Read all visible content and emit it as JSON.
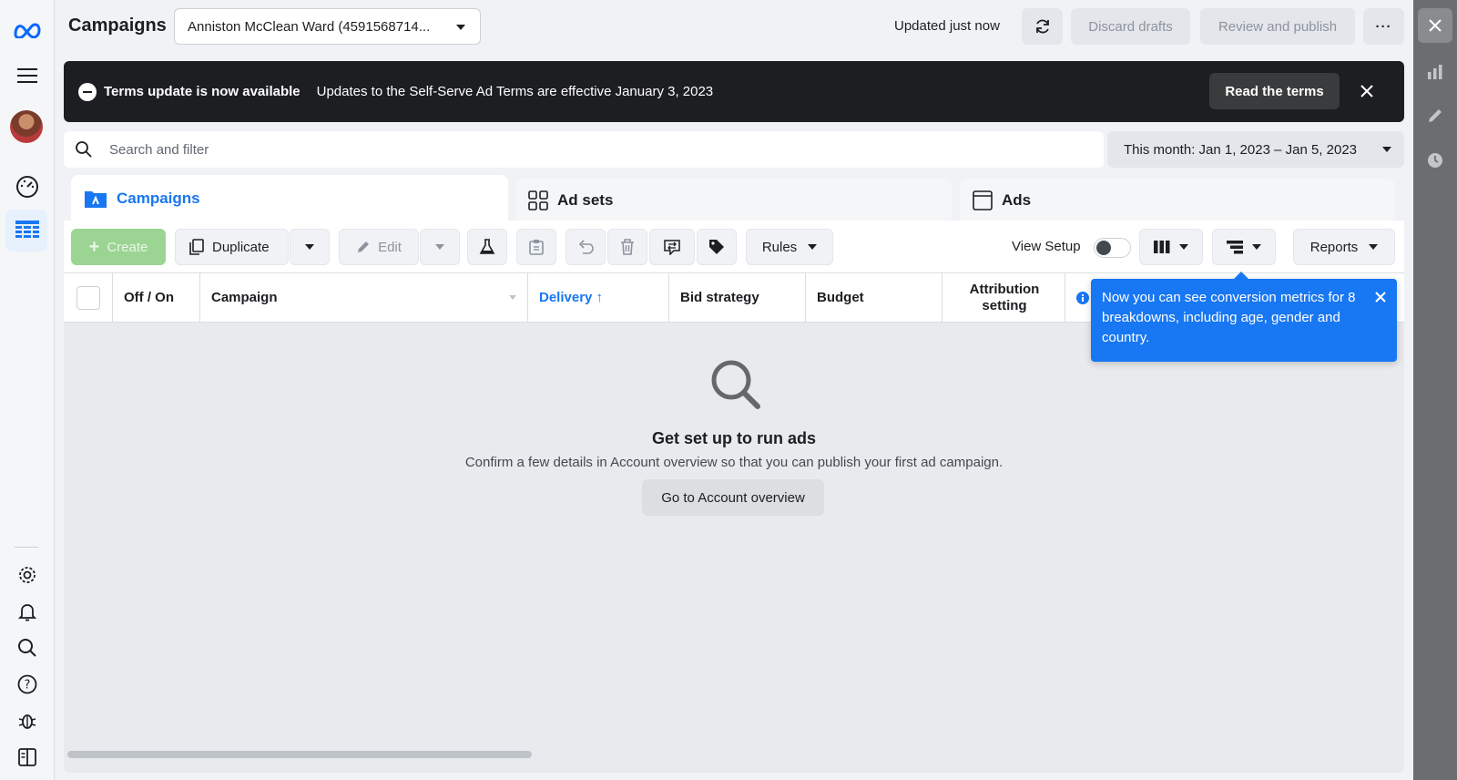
{
  "header": {
    "title": "Campaigns",
    "account_name": "Anniston McClean Ward (4591568714...",
    "status": "Updated just now",
    "discard_label": "Discard drafts",
    "review_label": "Review and publish",
    "more_label": "···"
  },
  "banner": {
    "title": "Terms update is now available",
    "message": "Updates to the Self-Serve Ad Terms are effective January 3, 2023",
    "button_label": "Read the terms"
  },
  "search": {
    "placeholder": "Search and filter"
  },
  "date_range": {
    "label": "This month: Jan 1, 2023 – Jan 5, 2023"
  },
  "tabs": [
    {
      "label": "Campaigns",
      "active": true
    },
    {
      "label": "Ad sets",
      "active": false
    },
    {
      "label": "Ads",
      "active": false
    }
  ],
  "toolbar": {
    "create_label": "Create",
    "duplicate_label": "Duplicate",
    "edit_label": "Edit",
    "rules_label": "Rules",
    "view_setup_label": "View Setup",
    "view_setup_on": false,
    "reports_label": "Reports"
  },
  "table": {
    "columns": [
      "Off / On",
      "Campaign",
      "Delivery ↑",
      "Bid strategy",
      "Budget",
      "Attribution setting"
    ]
  },
  "empty_state": {
    "title": "Get set up to run ads",
    "message": "Confirm a few details in Account overview so that you can publish your first ad campaign.",
    "button_label": "Go to Account overview"
  },
  "tooltip": {
    "text": "Now you can see conversion metrics for 8 breakdowns, including age, gender and country."
  },
  "colors": {
    "accent": "#1877f2",
    "create_green": "#9cd494",
    "banner_bg": "#1c1e21"
  }
}
